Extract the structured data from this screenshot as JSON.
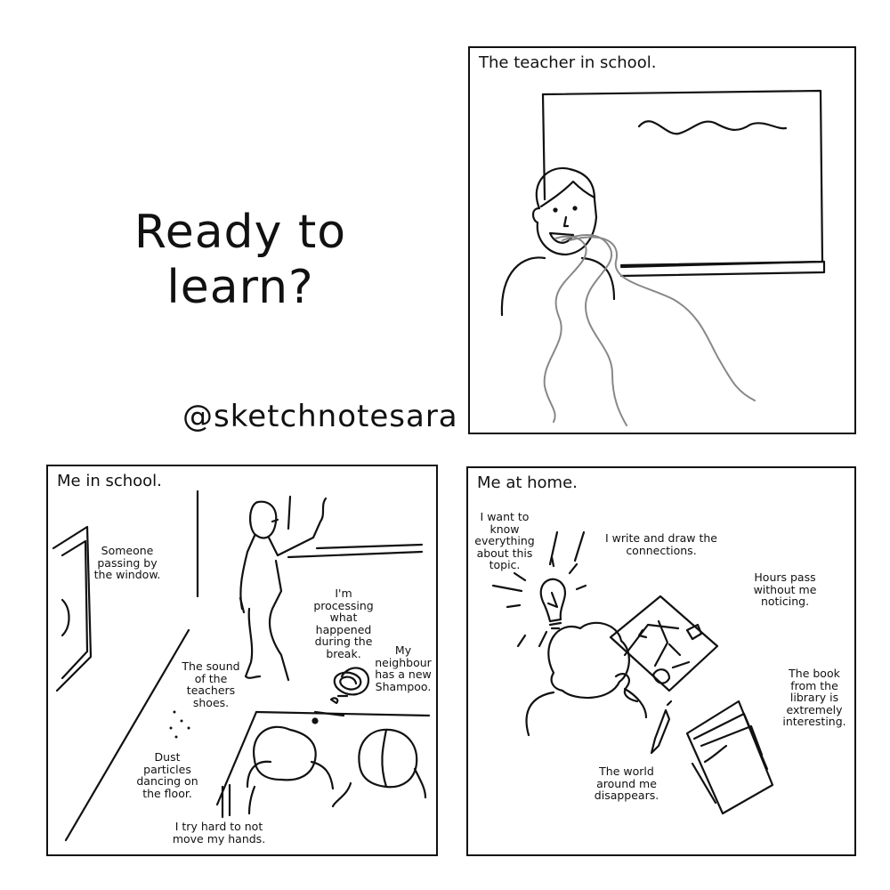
{
  "title": {
    "line1": "Ready to",
    "line2": "learn?"
  },
  "handle": "@sketchnotesara",
  "panel_teacher": {
    "title": "The teacher in school."
  },
  "panel_school": {
    "title": "Me in school.",
    "notes": {
      "window": "Someone passing by the window.",
      "processing": "I'm processing what happened during the break.",
      "neighbour": "My neighbour has a new Shampoo.",
      "shoes": "The sound of the teachers shoes.",
      "dust": "Dust particles dancing on the floor.",
      "hands": "I try hard to not move my hands."
    }
  },
  "panel_home": {
    "title": "Me at home.",
    "notes": {
      "know": "I want to know everything about this topic.",
      "write": "I write and draw the connections.",
      "hours": "Hours pass without me noticing.",
      "book": "The book from the library is extremely interesting.",
      "world": "The world around me disappears."
    }
  }
}
